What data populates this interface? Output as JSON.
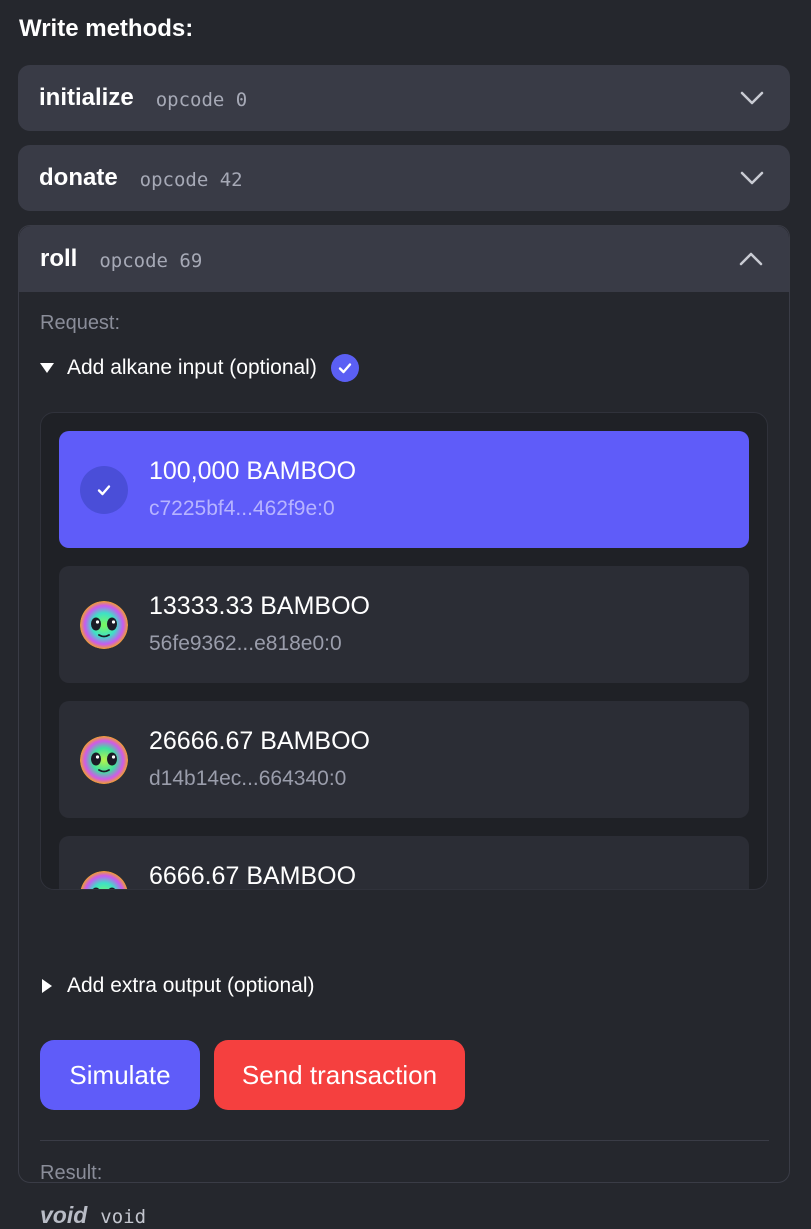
{
  "section_title": "Write methods:",
  "methods": [
    {
      "name": "initialize",
      "opcode": "opcode 0"
    },
    {
      "name": "donate",
      "opcode": "opcode 42"
    },
    {
      "name": "roll",
      "opcode": "opcode 69"
    }
  ],
  "roll_panel": {
    "request_label": "Request:",
    "alkane_input_label": "Add alkane input (optional)",
    "alkanes": [
      {
        "amount": "100,000 BAMBOO",
        "id": "c7225bf4...462f9e:0",
        "selected": true
      },
      {
        "amount": "13333.33 BAMBOO",
        "id": "56fe9362...e818e0:0",
        "selected": false
      },
      {
        "amount": "26666.67 BAMBOO",
        "id": "d14b14ec...664340:0",
        "selected": false
      },
      {
        "amount": "6666.67 BAMBOO",
        "id": "",
        "selected": false
      }
    ],
    "extra_output_label": "Add extra output (optional)",
    "simulate_label": "Simulate",
    "send_label": "Send transaction",
    "result_label": "Result:",
    "result_type": "void",
    "result_value": "void"
  },
  "colors": {
    "accent": "#5f5cf9",
    "danger": "#f5403f",
    "panel": "#393b46",
    "background": "#25272d"
  }
}
